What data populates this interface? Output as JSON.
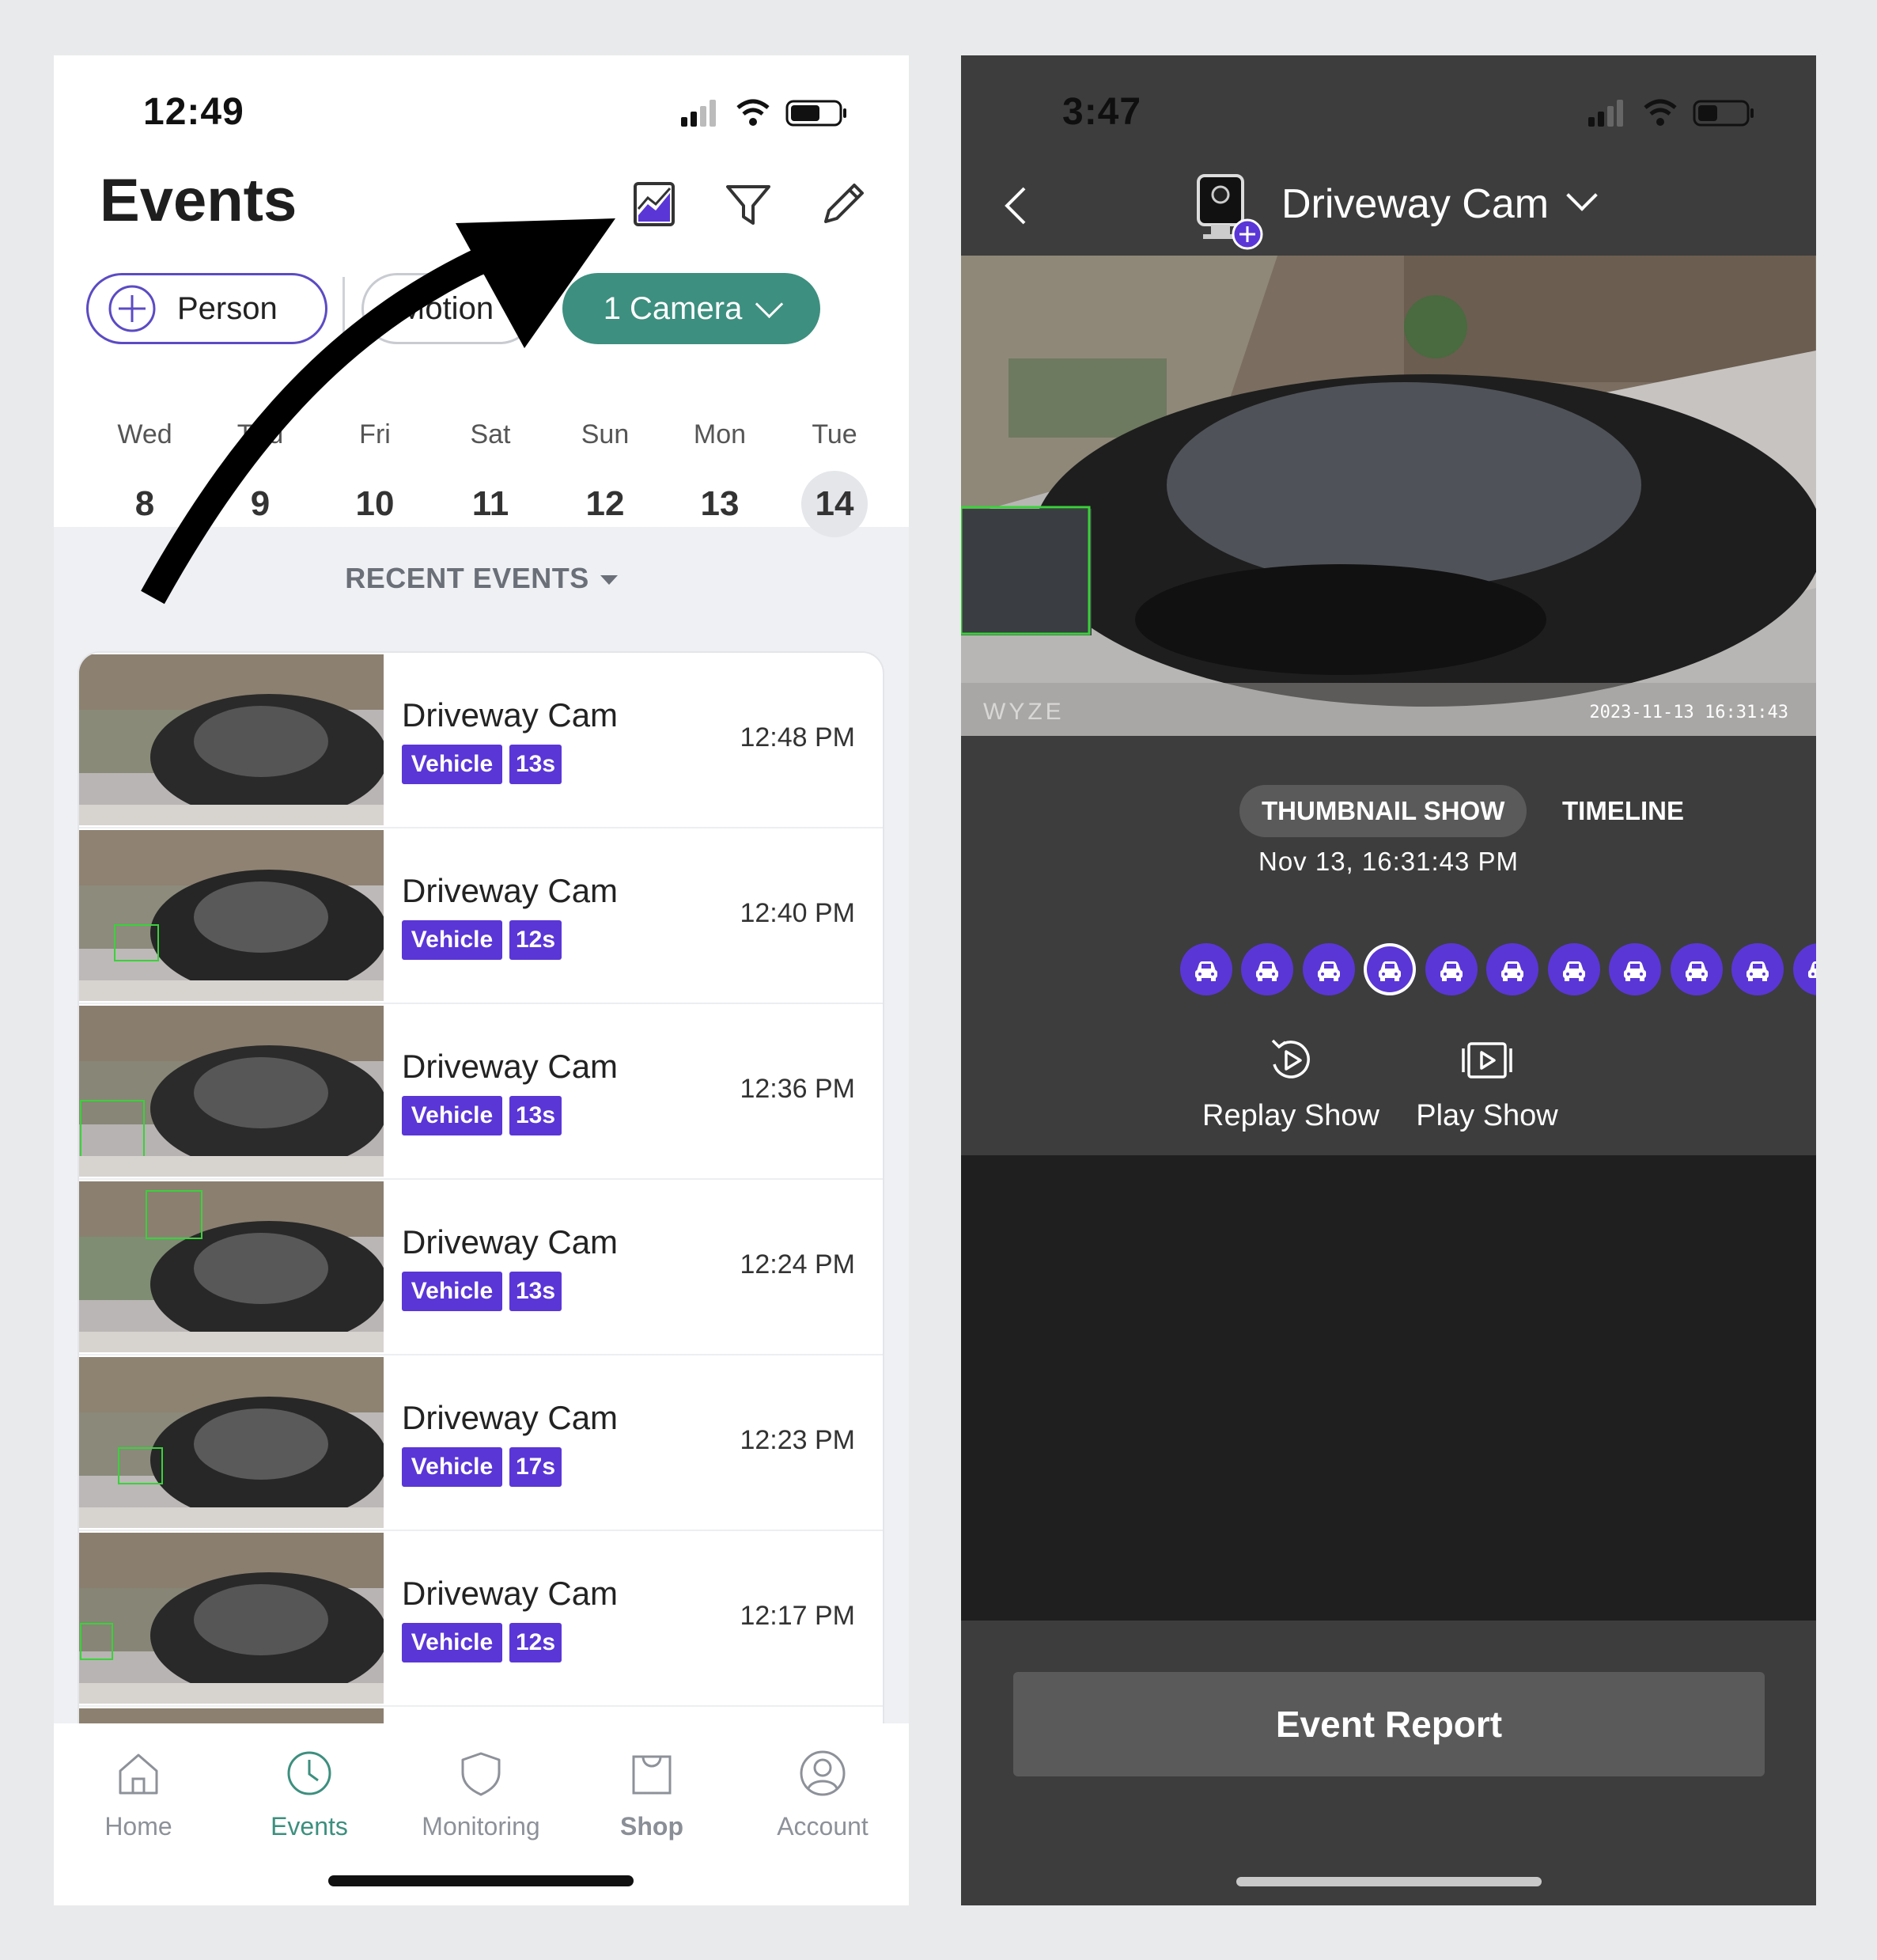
{
  "left": {
    "status_time": "12:49",
    "title": "Events",
    "chips": {
      "person": "Person",
      "motion": "Motion",
      "camera": "1 Camera"
    },
    "days": [
      {
        "name": "Wed",
        "date": "8"
      },
      {
        "name": "Thu",
        "date": "9"
      },
      {
        "name": "Fri",
        "date": "10"
      },
      {
        "name": "Sat",
        "date": "11"
      },
      {
        "name": "Sun",
        "date": "12"
      },
      {
        "name": "Mon",
        "date": "13"
      },
      {
        "name": "Tue",
        "date": "14"
      }
    ],
    "recent_label": "RECENT EVENTS",
    "events": [
      {
        "camera": "Driveway Cam",
        "type": "Vehicle",
        "duration": "13s",
        "time": "12:48 PM"
      },
      {
        "camera": "Driveway Cam",
        "type": "Vehicle",
        "duration": "12s",
        "time": "12:40 PM"
      },
      {
        "camera": "Driveway Cam",
        "type": "Vehicle",
        "duration": "13s",
        "time": "12:36 PM"
      },
      {
        "camera": "Driveway Cam",
        "type": "Vehicle",
        "duration": "13s",
        "time": "12:24 PM"
      },
      {
        "camera": "Driveway Cam",
        "type": "Vehicle",
        "duration": "17s",
        "time": "12:23 PM"
      },
      {
        "camera": "Driveway Cam",
        "type": "Vehicle",
        "duration": "12s",
        "time": "12:17 PM"
      }
    ],
    "tabs": {
      "home": "Home",
      "events": "Events",
      "monitoring": "Monitoring",
      "shop": "Shop",
      "account": "Account"
    }
  },
  "right": {
    "status_time": "3:47",
    "camera_name": "Driveway Cam",
    "watermark": "WYZE",
    "timestamp": "2023-11-13 16:31:43",
    "segment_thumbnail": "THUMBNAIL SHOW",
    "segment_timeline": "TIMELINE",
    "date": "Nov 13, 16:31:43 PM",
    "replay_label": "Replay Show",
    "play_label": "Play Show",
    "report_button": "Event Report"
  },
  "colors": {
    "accent_purple": "#5a36d6",
    "accent_green": "#3d8f7f",
    "dark_bg": "#3d3d3d"
  },
  "icons": {
    "header": [
      "chart-icon",
      "filter-icon",
      "edit-icon"
    ],
    "tabs": [
      "home-icon",
      "clock-icon",
      "shield-icon",
      "bag-icon",
      "user-icon"
    ],
    "actions": [
      "replay-icon",
      "play-icon"
    ],
    "events": "car-icon"
  }
}
